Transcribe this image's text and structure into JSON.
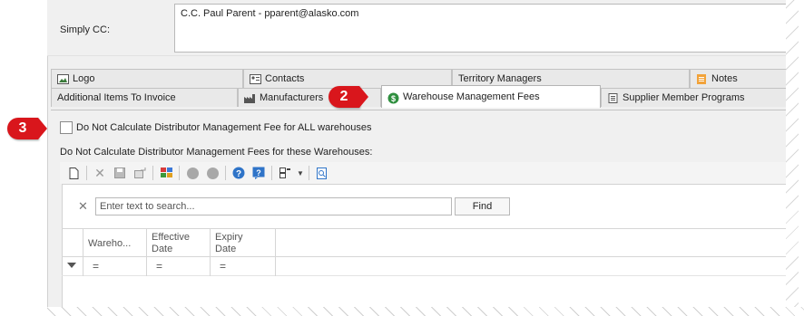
{
  "cc": {
    "label": "Simply CC:",
    "value": "C.C. Paul Parent - pparent@alasko.com"
  },
  "tabs_row1": [
    {
      "label": "Logo",
      "icon": "image-icon"
    },
    {
      "label": "Contacts",
      "icon": "contact-card-icon"
    },
    {
      "label": "Territory Managers",
      "icon": ""
    },
    {
      "label": "Notes",
      "icon": "notes-icon"
    }
  ],
  "tabs_row2": [
    {
      "label": "Additional Items To Invoice",
      "icon": ""
    },
    {
      "label": "Manufacturers",
      "icon": "factory-icon"
    },
    {
      "label": "Warehouse Management Fees",
      "icon": "dollar-icon",
      "active": true
    },
    {
      "label": "Supplier Member Programs",
      "icon": "document-icon"
    }
  ],
  "panel": {
    "checkbox_label": "Do Not Calculate Distributor Management Fee for ALL warehouses",
    "checkbox_checked": false,
    "subtitle": "Do Not Calculate Distributor Management Fees for these Warehouses:"
  },
  "toolbar": {
    "icons": [
      "new-icon",
      "delete-icon",
      "save-icon",
      "export-icon",
      "columns-icon",
      "up-icon",
      "down-icon",
      "help-icon",
      "question-icon",
      "layout-icon",
      "dropdown-icon",
      "preview-icon"
    ]
  },
  "search": {
    "placeholder": "Enter text to search...",
    "find_label": "Find",
    "clear_symbol": "✕"
  },
  "grid": {
    "columns": [
      {
        "line1": "Wareho...",
        "line2": ""
      },
      {
        "line1": "Effective",
        "line2": "Date"
      },
      {
        "line1": "Expiry",
        "line2": "Date"
      }
    ],
    "filter_symbol": "="
  },
  "callouts": {
    "two": "2",
    "three": "3"
  },
  "colors": {
    "callout": "#d9161c",
    "active_tab": "#ffffff",
    "panel_bg": "#f0f0f0"
  }
}
